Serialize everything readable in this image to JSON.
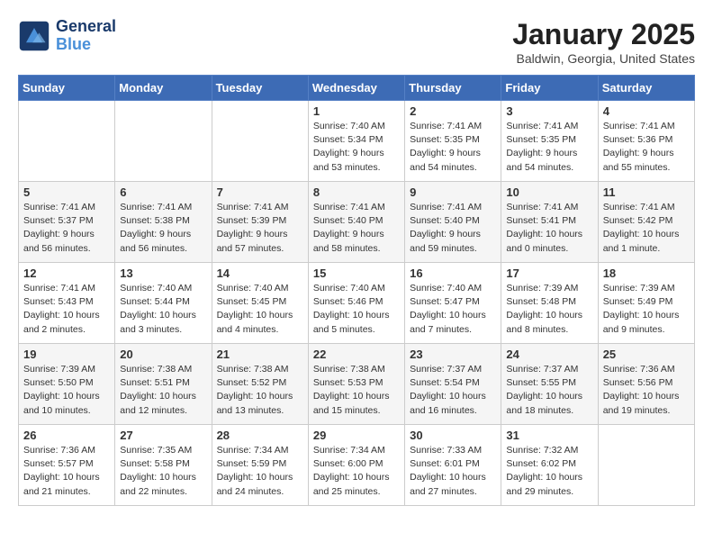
{
  "header": {
    "logo_line1": "General",
    "logo_line2": "Blue",
    "month": "January 2025",
    "location": "Baldwin, Georgia, United States"
  },
  "days_of_week": [
    "Sunday",
    "Monday",
    "Tuesday",
    "Wednesday",
    "Thursday",
    "Friday",
    "Saturday"
  ],
  "weeks": [
    [
      {
        "day": "",
        "info": ""
      },
      {
        "day": "",
        "info": ""
      },
      {
        "day": "",
        "info": ""
      },
      {
        "day": "1",
        "info": "Sunrise: 7:40 AM\nSunset: 5:34 PM\nDaylight: 9 hours\nand 53 minutes."
      },
      {
        "day": "2",
        "info": "Sunrise: 7:41 AM\nSunset: 5:35 PM\nDaylight: 9 hours\nand 54 minutes."
      },
      {
        "day": "3",
        "info": "Sunrise: 7:41 AM\nSunset: 5:35 PM\nDaylight: 9 hours\nand 54 minutes."
      },
      {
        "day": "4",
        "info": "Sunrise: 7:41 AM\nSunset: 5:36 PM\nDaylight: 9 hours\nand 55 minutes."
      }
    ],
    [
      {
        "day": "5",
        "info": "Sunrise: 7:41 AM\nSunset: 5:37 PM\nDaylight: 9 hours\nand 56 minutes."
      },
      {
        "day": "6",
        "info": "Sunrise: 7:41 AM\nSunset: 5:38 PM\nDaylight: 9 hours\nand 56 minutes."
      },
      {
        "day": "7",
        "info": "Sunrise: 7:41 AM\nSunset: 5:39 PM\nDaylight: 9 hours\nand 57 minutes."
      },
      {
        "day": "8",
        "info": "Sunrise: 7:41 AM\nSunset: 5:40 PM\nDaylight: 9 hours\nand 58 minutes."
      },
      {
        "day": "9",
        "info": "Sunrise: 7:41 AM\nSunset: 5:40 PM\nDaylight: 9 hours\nand 59 minutes."
      },
      {
        "day": "10",
        "info": "Sunrise: 7:41 AM\nSunset: 5:41 PM\nDaylight: 10 hours\nand 0 minutes."
      },
      {
        "day": "11",
        "info": "Sunrise: 7:41 AM\nSunset: 5:42 PM\nDaylight: 10 hours\nand 1 minute."
      }
    ],
    [
      {
        "day": "12",
        "info": "Sunrise: 7:41 AM\nSunset: 5:43 PM\nDaylight: 10 hours\nand 2 minutes."
      },
      {
        "day": "13",
        "info": "Sunrise: 7:40 AM\nSunset: 5:44 PM\nDaylight: 10 hours\nand 3 minutes."
      },
      {
        "day": "14",
        "info": "Sunrise: 7:40 AM\nSunset: 5:45 PM\nDaylight: 10 hours\nand 4 minutes."
      },
      {
        "day": "15",
        "info": "Sunrise: 7:40 AM\nSunset: 5:46 PM\nDaylight: 10 hours\nand 5 minutes."
      },
      {
        "day": "16",
        "info": "Sunrise: 7:40 AM\nSunset: 5:47 PM\nDaylight: 10 hours\nand 7 minutes."
      },
      {
        "day": "17",
        "info": "Sunrise: 7:39 AM\nSunset: 5:48 PM\nDaylight: 10 hours\nand 8 minutes."
      },
      {
        "day": "18",
        "info": "Sunrise: 7:39 AM\nSunset: 5:49 PM\nDaylight: 10 hours\nand 9 minutes."
      }
    ],
    [
      {
        "day": "19",
        "info": "Sunrise: 7:39 AM\nSunset: 5:50 PM\nDaylight: 10 hours\nand 10 minutes."
      },
      {
        "day": "20",
        "info": "Sunrise: 7:38 AM\nSunset: 5:51 PM\nDaylight: 10 hours\nand 12 minutes."
      },
      {
        "day": "21",
        "info": "Sunrise: 7:38 AM\nSunset: 5:52 PM\nDaylight: 10 hours\nand 13 minutes."
      },
      {
        "day": "22",
        "info": "Sunrise: 7:38 AM\nSunset: 5:53 PM\nDaylight: 10 hours\nand 15 minutes."
      },
      {
        "day": "23",
        "info": "Sunrise: 7:37 AM\nSunset: 5:54 PM\nDaylight: 10 hours\nand 16 minutes."
      },
      {
        "day": "24",
        "info": "Sunrise: 7:37 AM\nSunset: 5:55 PM\nDaylight: 10 hours\nand 18 minutes."
      },
      {
        "day": "25",
        "info": "Sunrise: 7:36 AM\nSunset: 5:56 PM\nDaylight: 10 hours\nand 19 minutes."
      }
    ],
    [
      {
        "day": "26",
        "info": "Sunrise: 7:36 AM\nSunset: 5:57 PM\nDaylight: 10 hours\nand 21 minutes."
      },
      {
        "day": "27",
        "info": "Sunrise: 7:35 AM\nSunset: 5:58 PM\nDaylight: 10 hours\nand 22 minutes."
      },
      {
        "day": "28",
        "info": "Sunrise: 7:34 AM\nSunset: 5:59 PM\nDaylight: 10 hours\nand 24 minutes."
      },
      {
        "day": "29",
        "info": "Sunrise: 7:34 AM\nSunset: 6:00 PM\nDaylight: 10 hours\nand 25 minutes."
      },
      {
        "day": "30",
        "info": "Sunrise: 7:33 AM\nSunset: 6:01 PM\nDaylight: 10 hours\nand 27 minutes."
      },
      {
        "day": "31",
        "info": "Sunrise: 7:32 AM\nSunset: 6:02 PM\nDaylight: 10 hours\nand 29 minutes."
      },
      {
        "day": "",
        "info": ""
      }
    ]
  ]
}
